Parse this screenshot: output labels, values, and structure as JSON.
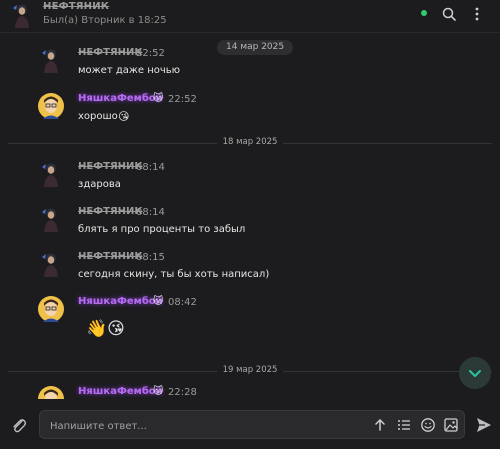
{
  "header": {
    "title": "НЕФТЯНИК",
    "status": "Был(а) Вторник в 18:25",
    "online_color": "#2ecc71",
    "icons": [
      "search-icon",
      "kebab-menu-icon"
    ]
  },
  "messages": [
    {
      "kind": "date_pill",
      "label": "14 мар 2025"
    },
    {
      "author": "НЕФТЯНИК",
      "time": "22:52",
      "text": "может даже ночью",
      "avatar": "neft"
    },
    {
      "author": "НяшкаФембой",
      "badge": "🐱",
      "time": "22:52",
      "text": "хорошо",
      "emoji": "😘",
      "avatar": "nyash"
    },
    {
      "kind": "date_sep",
      "label": "18 мар 2025"
    },
    {
      "author": "НЕФТЯНИК",
      "time": "08:14",
      "text": "здарова",
      "avatar": "neft"
    },
    {
      "author": "НЕФТЯНИК",
      "time": "08:14",
      "text": "блять я про проценты то забыл",
      "avatar": "neft"
    },
    {
      "author": "НЕФТЯНИК",
      "time": "08:15",
      "text": "сегодня скину, ты бы хоть написал)",
      "avatar": "neft"
    },
    {
      "author": "НяшкаФембой",
      "badge": "🐱",
      "time": "08:42",
      "sticker": "👋😘",
      "avatar": "nyash"
    },
    {
      "kind": "date_sep",
      "label": "19 мар 2025"
    },
    {
      "author": "НяшкаФембой",
      "badge": "🐱",
      "time": "22:28",
      "avatar": "nyash"
    }
  ],
  "composer": {
    "placeholder": "Напишите ответ...",
    "tools": [
      "arrow-up-icon",
      "list-format-icon",
      "emoji-icon",
      "image-icon"
    ]
  },
  "colors": {
    "background": "#1c1c1e",
    "accent": "#b56cf0",
    "scroll_button": "#26c6a0"
  }
}
